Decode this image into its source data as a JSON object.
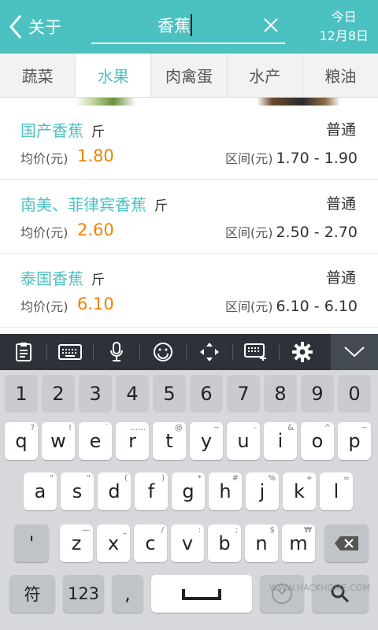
{
  "header": {
    "back_label": "关于",
    "search_value": "香蕉",
    "date_line1": "今日",
    "date_line2": "12月8日"
  },
  "tabs": [
    {
      "label": "蔬菜",
      "active": false
    },
    {
      "label": "水果",
      "active": true
    },
    {
      "label": "肉禽蛋",
      "active": false
    },
    {
      "label": "水产",
      "active": false
    },
    {
      "label": "粮油",
      "active": false
    }
  ],
  "items": [
    {
      "name": "国产香蕉",
      "unit": "斤",
      "grade": "普通",
      "avg_label": "均价(元)",
      "avg": "1.80",
      "range_label": "区间(元)",
      "range": "1.70 - 1.90"
    },
    {
      "name": "南美、菲律宾香蕉",
      "unit": "斤",
      "grade": "普通",
      "avg_label": "均价(元)",
      "avg": "2.60",
      "range_label": "区间(元)",
      "range": "2.50 - 2.70"
    },
    {
      "name": "泰国香蕉",
      "unit": "斤",
      "grade": "普通",
      "avg_label": "均价(元)",
      "avg": "6.10",
      "range_label": "区间(元)",
      "range": "6.10 - 6.10"
    }
  ],
  "keyboard": {
    "toolbar_icons": [
      "clipboard-icon",
      "keyboard-icon",
      "microphone-icon",
      "emoji-icon",
      "cursor-move-icon",
      "keyboard-switch-icon",
      "gear-icon",
      "chevron-down-icon"
    ],
    "numbers": [
      "1",
      "2",
      "3",
      "4",
      "5",
      "6",
      "7",
      "8",
      "9",
      "0"
    ],
    "row1": [
      {
        "k": "q",
        "h": "?"
      },
      {
        "k": "w",
        "h": "!"
      },
      {
        "k": "e",
        "h": "`"
      },
      {
        "k": "r",
        "h": "……"
      },
      {
        "k": "t",
        "h": "@"
      },
      {
        "k": "y",
        "h": "~"
      },
      {
        "k": "u",
        "h": "-"
      },
      {
        "k": "i",
        "h": "&"
      },
      {
        "k": "o",
        "h": "^"
      },
      {
        "k": "p",
        "h": "~"
      }
    ],
    "row2": [
      {
        "k": "a",
        "h": "\""
      },
      {
        "k": "s",
        "h": "\""
      },
      {
        "k": "d",
        "h": "("
      },
      {
        "k": "f",
        "h": ")"
      },
      {
        "k": "g",
        "h": "*"
      },
      {
        "k": "h",
        "h": "#"
      },
      {
        "k": "j",
        "h": "%"
      },
      {
        "k": "k",
        "h": "+"
      },
      {
        "k": "l",
        "h": "="
      }
    ],
    "row3": [
      {
        "k": "z",
        "h": "—"
      },
      {
        "k": "x",
        "h": "_"
      },
      {
        "k": "c",
        "h": "/"
      },
      {
        "k": "v",
        "h": ":"
      },
      {
        "k": "b",
        "h": ";"
      },
      {
        "k": "n",
        "h": "$"
      },
      {
        "k": "m",
        "h": "₩"
      }
    ],
    "apostrophe": "'",
    "symbol_key": "符",
    "num_key": "123",
    "comma_key": ",",
    "watermark": "WWW.HACKHOME.COM"
  }
}
